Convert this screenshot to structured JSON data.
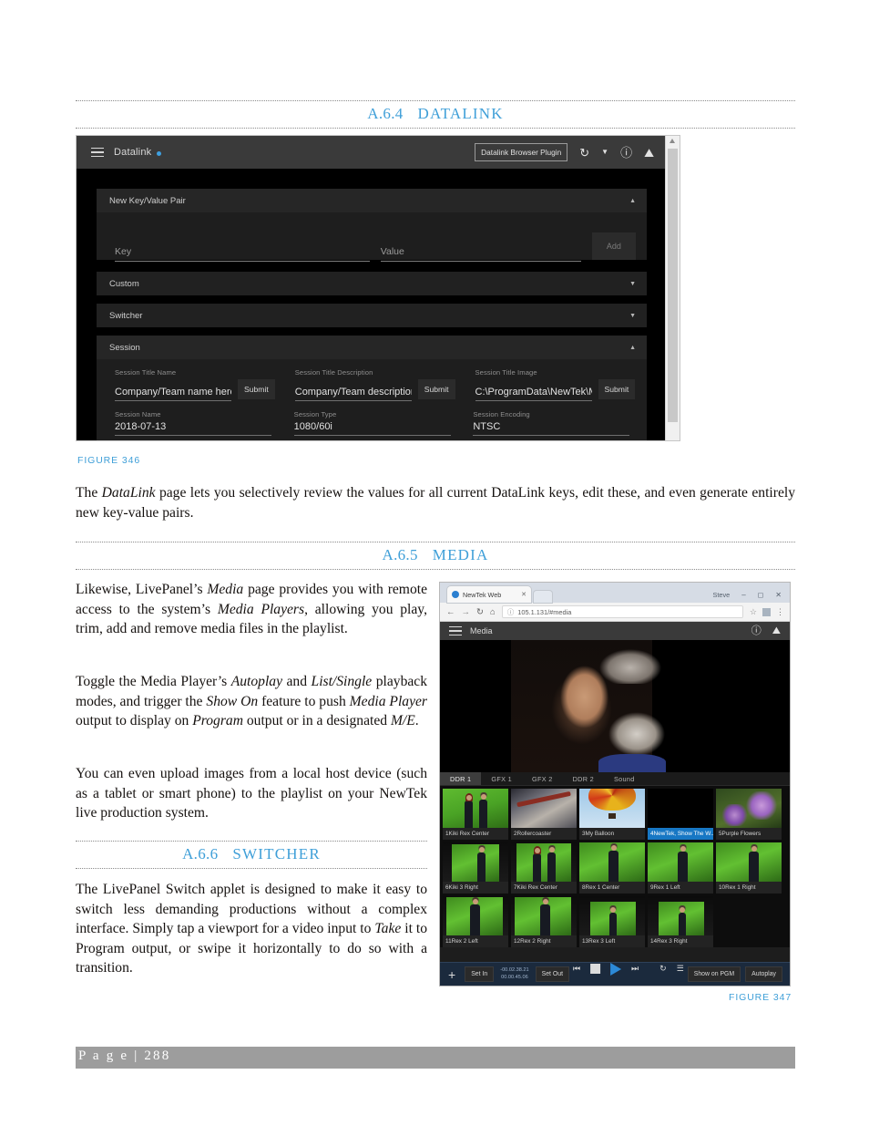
{
  "page": {
    "footer_label": "P a g e  |  288"
  },
  "sections": {
    "datalink": {
      "num": "A.6.4",
      "title": "DATALINK"
    },
    "media": {
      "num": "A.6.5",
      "title": "MEDIA"
    },
    "switcher": {
      "num": "A.6.6",
      "title": "SWITCHER"
    }
  },
  "captions": {
    "fig346": "FIGURE 346",
    "fig347": "FIGURE 347"
  },
  "paragraphs": {
    "datalink_body_1": "The ",
    "datalink_body_1_em": "DataLink",
    "datalink_body_2": " page lets you selectively review the values for all current DataLink keys, edit these, and even generate entirely new key-value pairs.",
    "media_p1_a": "Likewise, LivePanel’s ",
    "media_p1_em1": "Media",
    "media_p1_b": " page provides you with remote access to the system’s ",
    "media_p1_em2": "Media Players",
    "media_p1_c": ", allowing you play, trim, add and remove media files in the playlist.",
    "media_p2_a": "Toggle the Media Player’s ",
    "media_p2_em1": "Autoplay",
    "media_p2_b": " and ",
    "media_p2_em2": "List/Single",
    "media_p2_c": " playback modes, and trigger the ",
    "media_p2_em3": "Show On",
    "media_p2_d": " feature to push ",
    "media_p2_em4": "Media Player",
    "media_p2_e": " output to display on ",
    "media_p2_em5": "Program",
    "media_p2_f": " output or in a designated ",
    "media_p2_em6": "M/E",
    "media_p2_g": ".",
    "media_p3": "You can even upload images from a local host device (such as a tablet or smart phone) to the playlist on your NewTek live production system.",
    "switcher_p1_a": "The LivePanel Switch applet is designed to make it easy to switch less demanding productions without a complex interface.  Simply tap a viewport for a video input to ",
    "switcher_p1_em": "Take",
    "switcher_p1_b": " it to Program output, or swipe it horizontally to do so with a transition."
  },
  "figure346": {
    "topbar": {
      "menu_icon": "hamburger-icon",
      "app_title": "Datalink",
      "plugin_button": "Datalink Browser Plugin",
      "refresh_icon": "refresh-icon",
      "dropdown_icon": "chevron-down-icon",
      "help_icon": "help-icon",
      "home_icon": "home-icon"
    },
    "panels": [
      {
        "title": "New Key/Value Pair",
        "expanded": true,
        "caret": "▲"
      },
      {
        "title": "Custom",
        "expanded": false,
        "caret": "▼"
      },
      {
        "title": "Switcher",
        "expanded": false,
        "caret": "▼"
      },
      {
        "title": "Session",
        "expanded": true,
        "caret": "▲"
      }
    ],
    "new_pair": {
      "key_placeholder": "Key",
      "value_placeholder": "Value",
      "add_label": "Add"
    },
    "session_fields": [
      {
        "label": "Session Title Name",
        "value": "Company/Team name here ...",
        "submit": "Submit"
      },
      {
        "label": "Session Title Description",
        "value": "Company/Team description her",
        "submit": "Submit"
      },
      {
        "label": "Session Title Image",
        "value": "C:\\ProgramData\\NewTek\\Mediа",
        "submit": "Submit"
      },
      {
        "label": "Session Name",
        "value": "2018-07-13",
        "submit": ""
      },
      {
        "label": "Session Type",
        "value": "1080/60i",
        "submit": ""
      },
      {
        "label": "Session Encoding",
        "value": "NTSC",
        "submit": ""
      }
    ]
  },
  "figure347": {
    "browser": {
      "tab_title": "NewTek Web",
      "tab_close_icon": "close-icon",
      "new_tab_icon": "new-tab-icon",
      "user_label": "Steve",
      "minimize_icon": "minimize-icon",
      "maximize_icon": "maximize-icon",
      "close_window_icon": "close-icon",
      "back_icon": "back-arrow-icon",
      "forward_icon": "forward-arrow-icon",
      "reload_icon": "reload-icon",
      "home_icon": "home-icon",
      "info_icon": "info-icon",
      "url": "105.1.131/#media",
      "star_icon": "bookmark-star-icon",
      "extension_icon": "extension-icon",
      "menu_icon": "kebab-menu-icon"
    },
    "app_header": {
      "menu_icon": "hamburger-icon",
      "title": "Media",
      "help_icon": "help-icon",
      "home_icon": "home-icon"
    },
    "desk_tabs": [
      {
        "label": "DDR 1",
        "selected": true
      },
      {
        "label": "GFX 1",
        "selected": false
      },
      {
        "label": "GFX 2",
        "selected": false
      },
      {
        "label": "DDR 2",
        "selected": false
      },
      {
        "label": "Sound",
        "selected": false
      }
    ],
    "clips": [
      {
        "label": "1Kiki Rex Center",
        "art": "rc",
        "selected": false
      },
      {
        "label": "2Rollercoaster",
        "art": "roller",
        "selected": false
      },
      {
        "label": "3My Balloon",
        "art": "balloon",
        "selected": false
      },
      {
        "label": "4NewTek, Show The W..",
        "art": "black",
        "selected": true
      },
      {
        "label": "5Purple Flowers",
        "art": "flowers",
        "selected": false
      },
      {
        "label": "6Kiki 3 Right",
        "art": "g1",
        "selected": false
      },
      {
        "label": "7Kiki Rex Center",
        "art": "g2",
        "selected": false
      },
      {
        "label": "8Rex 1 Center",
        "art": "g3",
        "selected": false
      },
      {
        "label": "9Rex 1 Left",
        "art": "g4",
        "selected": false
      },
      {
        "label": "10Rex 1 Right",
        "art": "g5",
        "selected": false
      },
      {
        "label": "11Rex 2 Left",
        "art": "g6",
        "selected": false
      },
      {
        "label": "12Rex 2 Right",
        "art": "g7",
        "selected": false
      },
      {
        "label": "13Rex 3 Left",
        "art": "g8",
        "selected": false
      },
      {
        "label": "14Rex 3 Right",
        "art": "g9",
        "selected": false
      }
    ],
    "transport": {
      "add_icon": "plus-icon",
      "set_in_label": "Set In",
      "timecode_remaining": "-00.02.38.21",
      "timecode_position": "00.00.45.06",
      "set_out_label": "Set Out",
      "prev_icon": "previous-track-icon",
      "stop_icon": "stop-icon",
      "play_icon": "play-icon",
      "next_icon": "next-track-icon",
      "loop_icon": "loop-icon",
      "list_icon": "playlist-icon",
      "show_on_pgm_label": "Show on PGM",
      "autoplay_label": "Autoplay"
    }
  },
  "colors": {
    "accent_blue": "#3f9fd8",
    "selection_blue": "#1777c4",
    "transport_blue": "#1b2a3d",
    "footer_gray": "#9d9d9d"
  }
}
